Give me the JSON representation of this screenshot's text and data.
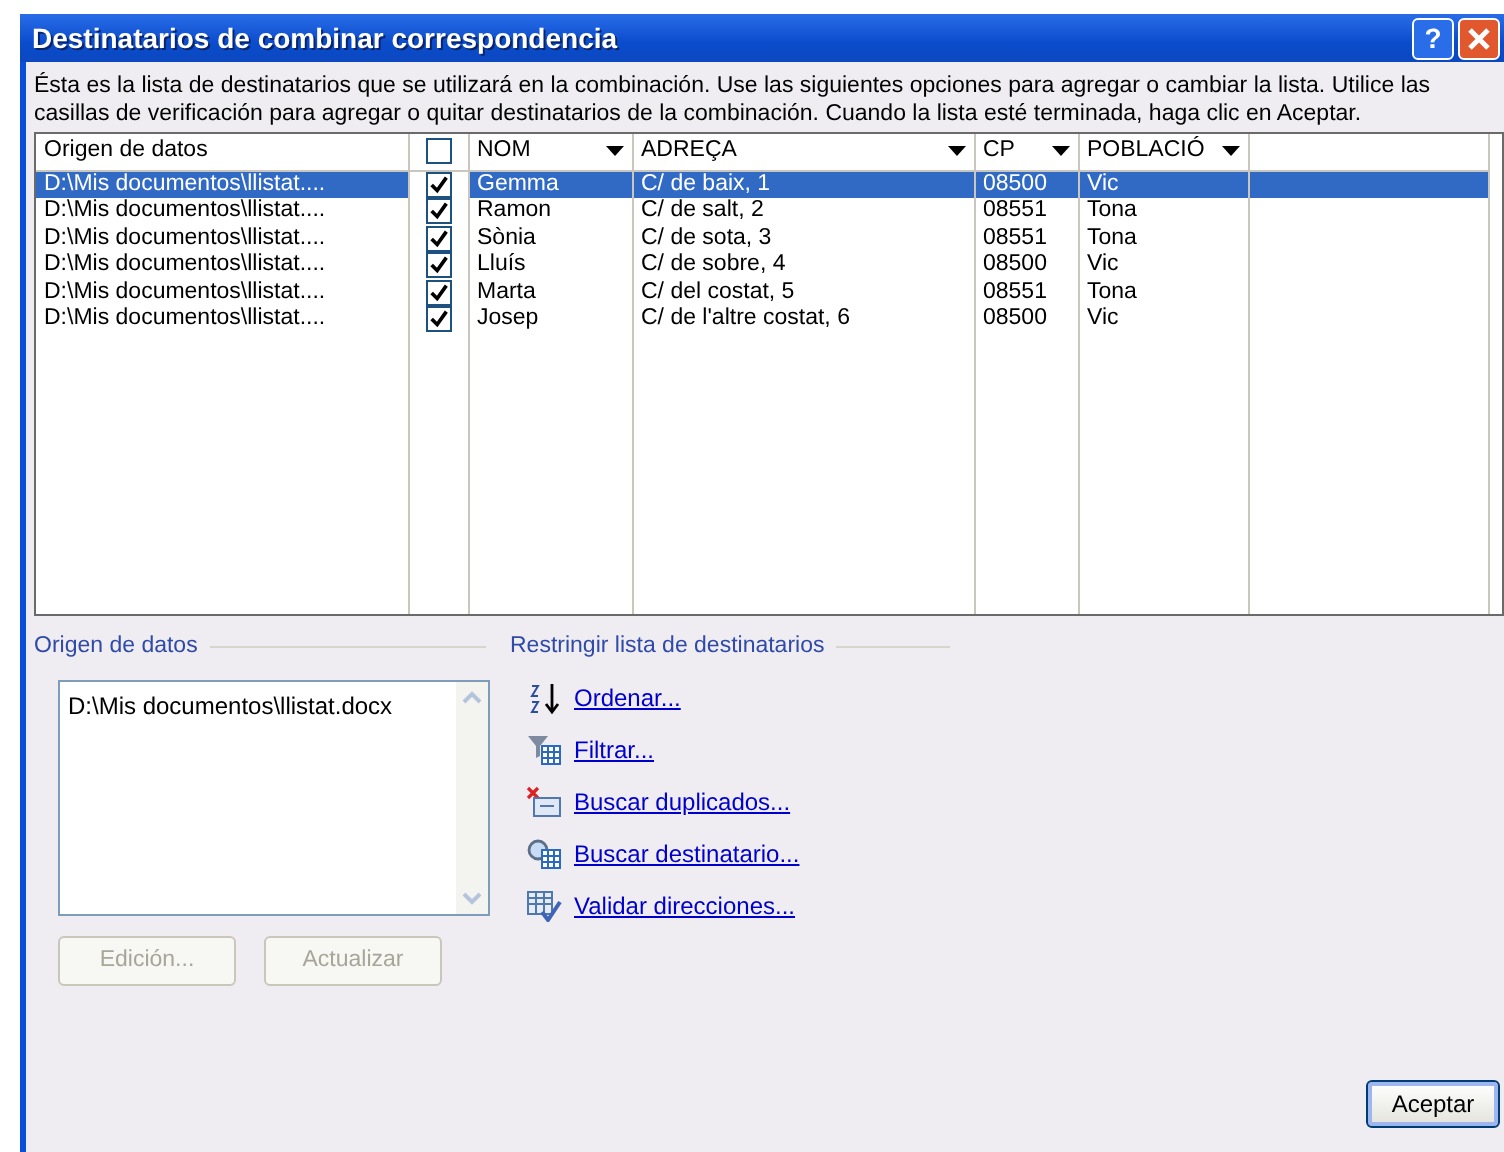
{
  "window": {
    "title": "Destinatarios de combinar correspondencia",
    "help": "?"
  },
  "intro": "Ésta es la lista de destinatarios que se utilizará en la combinación. Use las siguientes opciones para agregar o cambiar la lista. Utilice las casillas de verificación para agregar o quitar destinatarios de la combinación. Cuando la lista esté terminada, haga clic en Aceptar.",
  "table": {
    "columns": [
      {
        "kind": "text",
        "label": "Origen de datos",
        "filter": false
      },
      {
        "kind": "checkbox",
        "checked": false
      },
      {
        "kind": "text",
        "label": "NOM",
        "filter": true
      },
      {
        "kind": "text",
        "label": "ADREÇA",
        "filter": true
      },
      {
        "kind": "text",
        "label": "CP",
        "filter": true
      },
      {
        "kind": "text",
        "label": "POBLACIÓ",
        "filter": true
      }
    ],
    "rows": [
      {
        "checked": true,
        "selected": true,
        "cells": [
          "D:\\Mis documentos\\llistat....",
          "",
          "Gemma",
          "C/ de baix, 1",
          "08500",
          "Vic"
        ]
      },
      {
        "checked": true,
        "selected": false,
        "cells": [
          "D:\\Mis documentos\\llistat....",
          "",
          "Ramon",
          "C/ de salt, 2",
          "08551",
          "Tona"
        ]
      },
      {
        "checked": true,
        "selected": false,
        "cells": [
          "D:\\Mis documentos\\llistat....",
          "",
          "Sònia",
          "C/ de sota, 3",
          "08551",
          "Tona"
        ]
      },
      {
        "checked": true,
        "selected": false,
        "cells": [
          "D:\\Mis documentos\\llistat....",
          "",
          "Lluís",
          "C/ de sobre, 4",
          "08500",
          "Vic"
        ]
      },
      {
        "checked": true,
        "selected": false,
        "cells": [
          "D:\\Mis documentos\\llistat....",
          "",
          "Marta",
          "C/ del costat, 5",
          "08551",
          "Tona"
        ]
      },
      {
        "checked": true,
        "selected": false,
        "cells": [
          "D:\\Mis documentos\\llistat....",
          "",
          "Josep",
          "C/ de l'altre costat, 6",
          "08500",
          "Vic"
        ]
      }
    ]
  },
  "data_source": {
    "label": "Origen de datos",
    "items": [
      "D:\\Mis documentos\\llistat.docx"
    ],
    "buttons": [
      {
        "label": "Edición...",
        "disabled": true
      },
      {
        "label": "Actualizar",
        "disabled": true
      }
    ]
  },
  "restrict": {
    "label": "Restringir lista de destinatarios",
    "links": [
      {
        "kind": "sort",
        "label": "Ordenar..."
      },
      {
        "kind": "filter",
        "label": "Filtrar..."
      },
      {
        "kind": "duplicates",
        "label": "Buscar duplicados..."
      },
      {
        "kind": "find",
        "label": "Buscar destinatario..."
      },
      {
        "kind": "validate",
        "label": "Validar direcciones..."
      }
    ]
  },
  "ok_button": "Aceptar"
}
